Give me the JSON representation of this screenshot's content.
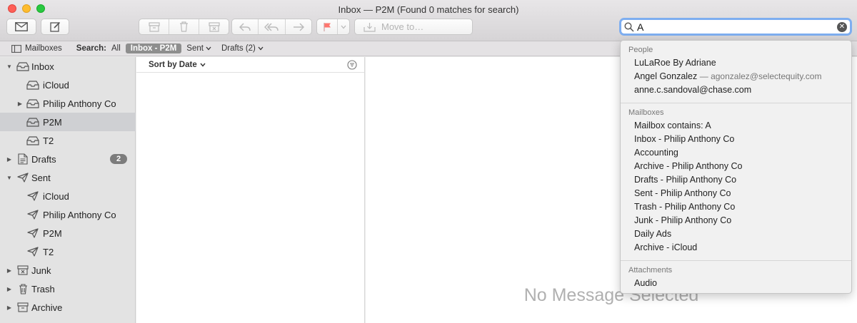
{
  "window": {
    "title": "Inbox — P2M (Found 0 matches for search)"
  },
  "toolbar": {
    "get_mail_icon": "envelope-icon",
    "compose_icon": "compose-icon",
    "archive_icon": "archive-icon",
    "trash_icon": "trash-icon",
    "junk_icon": "junk-icon",
    "reply_icon": "reply-icon",
    "reply_all_icon": "reply-all-icon",
    "forward_icon": "forward-icon",
    "flag_icon": "flag-icon",
    "flag_color": "#ff5f57",
    "move_to_label": "Move to…"
  },
  "search": {
    "value": "A",
    "focus_ring_color": "#7eaef0"
  },
  "favorites": {
    "mailboxes_label": "Mailboxes",
    "search_label": "Search:",
    "all_label": "All",
    "selected_label": "Inbox - P2M",
    "sent_label": "Sent",
    "drafts_label": "Drafts (2)"
  },
  "sidebar": {
    "items": [
      {
        "label": "Inbox",
        "icon": "inbox-icon",
        "expanded": true
      },
      {
        "label": "iCloud",
        "icon": "inbox-icon"
      },
      {
        "label": "Philip Anthony Co",
        "icon": "inbox-icon",
        "collapsed": true
      },
      {
        "label": "P2M",
        "icon": "inbox-icon",
        "selected": true
      },
      {
        "label": "T2",
        "icon": "inbox-icon"
      },
      {
        "label": "Drafts",
        "icon": "document-icon",
        "badge": "2"
      },
      {
        "label": "Sent",
        "icon": "paper-plane-icon",
        "expanded": true
      },
      {
        "label": "iCloud",
        "icon": "paper-plane-icon"
      },
      {
        "label": "Philip Anthony Co",
        "icon": "paper-plane-icon"
      },
      {
        "label": "P2M",
        "icon": "paper-plane-icon"
      },
      {
        "label": "T2",
        "icon": "paper-plane-icon"
      },
      {
        "label": "Junk",
        "icon": "junk-icon"
      },
      {
        "label": "Trash",
        "icon": "trash-icon"
      },
      {
        "label": "Archive",
        "icon": "archive-icon"
      }
    ]
  },
  "message_list": {
    "sort_label": "Sort by Date"
  },
  "viewer": {
    "empty_text": "No Message Selected"
  },
  "dropdown": {
    "people_header": "People",
    "people": [
      {
        "name": "LuLaRoe By Adriane",
        "email": ""
      },
      {
        "name": "Angel Gonzalez",
        "email": "— agonzalez@selectequity.com"
      },
      {
        "name": "anne.c.sandoval@chase.com",
        "email": ""
      }
    ],
    "mailboxes_header": "Mailboxes",
    "mailboxes": [
      "Mailbox contains: A",
      "Inbox - Philip Anthony Co",
      "Accounting",
      "Archive - Philip Anthony Co",
      "Drafts - Philip Anthony Co",
      "Sent - Philip Anthony Co",
      "Trash - Philip Anthony Co",
      "Junk - Philip Anthony Co",
      "Daily Ads",
      "Archive - iCloud"
    ],
    "attachments_header": "Attachments",
    "attachments": [
      "Audio"
    ]
  }
}
